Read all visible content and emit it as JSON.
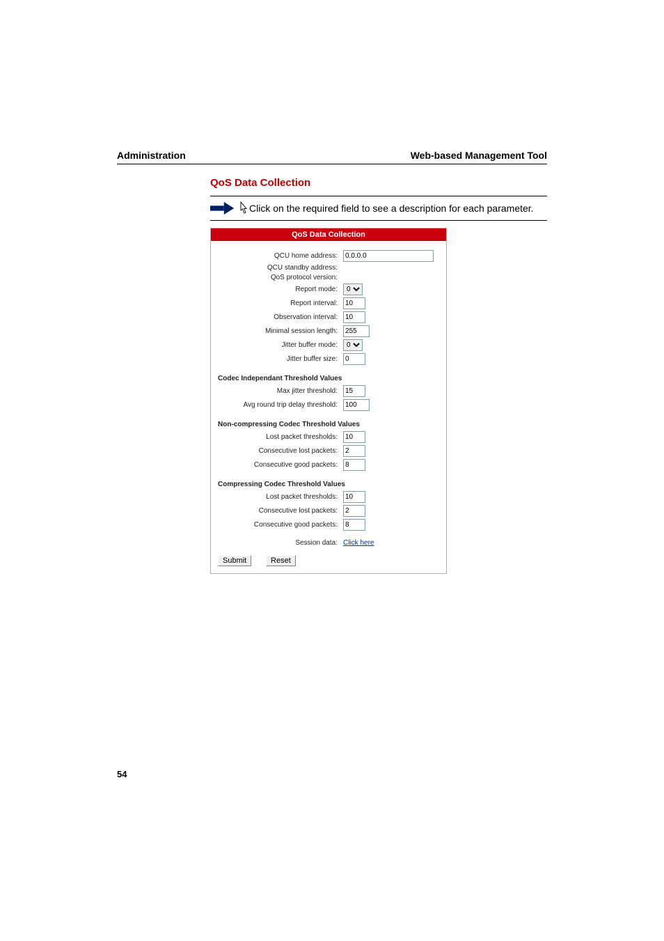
{
  "header": {
    "left": "Administration",
    "right": "Web-based Management Tool"
  },
  "section": {
    "title": "QoS Data Collection",
    "callout": "Click on the required field to see a description for each parameter."
  },
  "panel": {
    "header": "QoS Data Collection",
    "fields": {
      "qcu_home_address": {
        "label": "QCU home address:",
        "value": "0.0.0.0"
      },
      "qcu_standby_address": {
        "label": "QCU standby address:",
        "value": ""
      },
      "qos_protocol_version": {
        "label": "QoS protocol version:",
        "value": ""
      },
      "report_mode": {
        "label": "Report mode:",
        "value": "0"
      },
      "report_interval": {
        "label": "Report interval:",
        "value": "10"
      },
      "observation_interval": {
        "label": "Observation interval:",
        "value": "10"
      },
      "minimal_session_length": {
        "label": "Minimal session length:",
        "value": "255"
      },
      "jitter_buffer_mode": {
        "label": "Jitter buffer mode:",
        "value": "0"
      },
      "jitter_buffer_size": {
        "label": "Jitter buffer size:",
        "value": "0"
      }
    },
    "section1": {
      "heading": "Codec Independant Threshold Values",
      "max_jitter_threshold": {
        "label": "Max jitter threshold:",
        "value": "15"
      },
      "avg_round_trip_delay_threshold": {
        "label": "Avg round trip delay threshold:",
        "value": "100"
      }
    },
    "section2": {
      "heading": "Non-compressing Codec Threshold Values",
      "lost_packet_thresholds": {
        "label": "Lost packet thresholds:",
        "value": "10"
      },
      "consecutive_lost_packets": {
        "label": "Consecutive lost packets:",
        "value": "2"
      },
      "consecutive_good_packets": {
        "label": "Consecutive good packets:",
        "value": "8"
      }
    },
    "section3": {
      "heading": "Compressing Codec Threshold Values",
      "lost_packet_thresholds": {
        "label": "Lost packet thresholds:",
        "value": "10"
      },
      "consecutive_lost_packets": {
        "label": "Consecutive lost packets:",
        "value": "2"
      },
      "consecutive_good_packets": {
        "label": "Consecutive good packets:",
        "value": "8"
      }
    },
    "session_data": {
      "label": "Session data:",
      "link": "Click here"
    },
    "buttons": {
      "submit": "Submit",
      "reset": "Reset"
    }
  },
  "page_number": "54"
}
